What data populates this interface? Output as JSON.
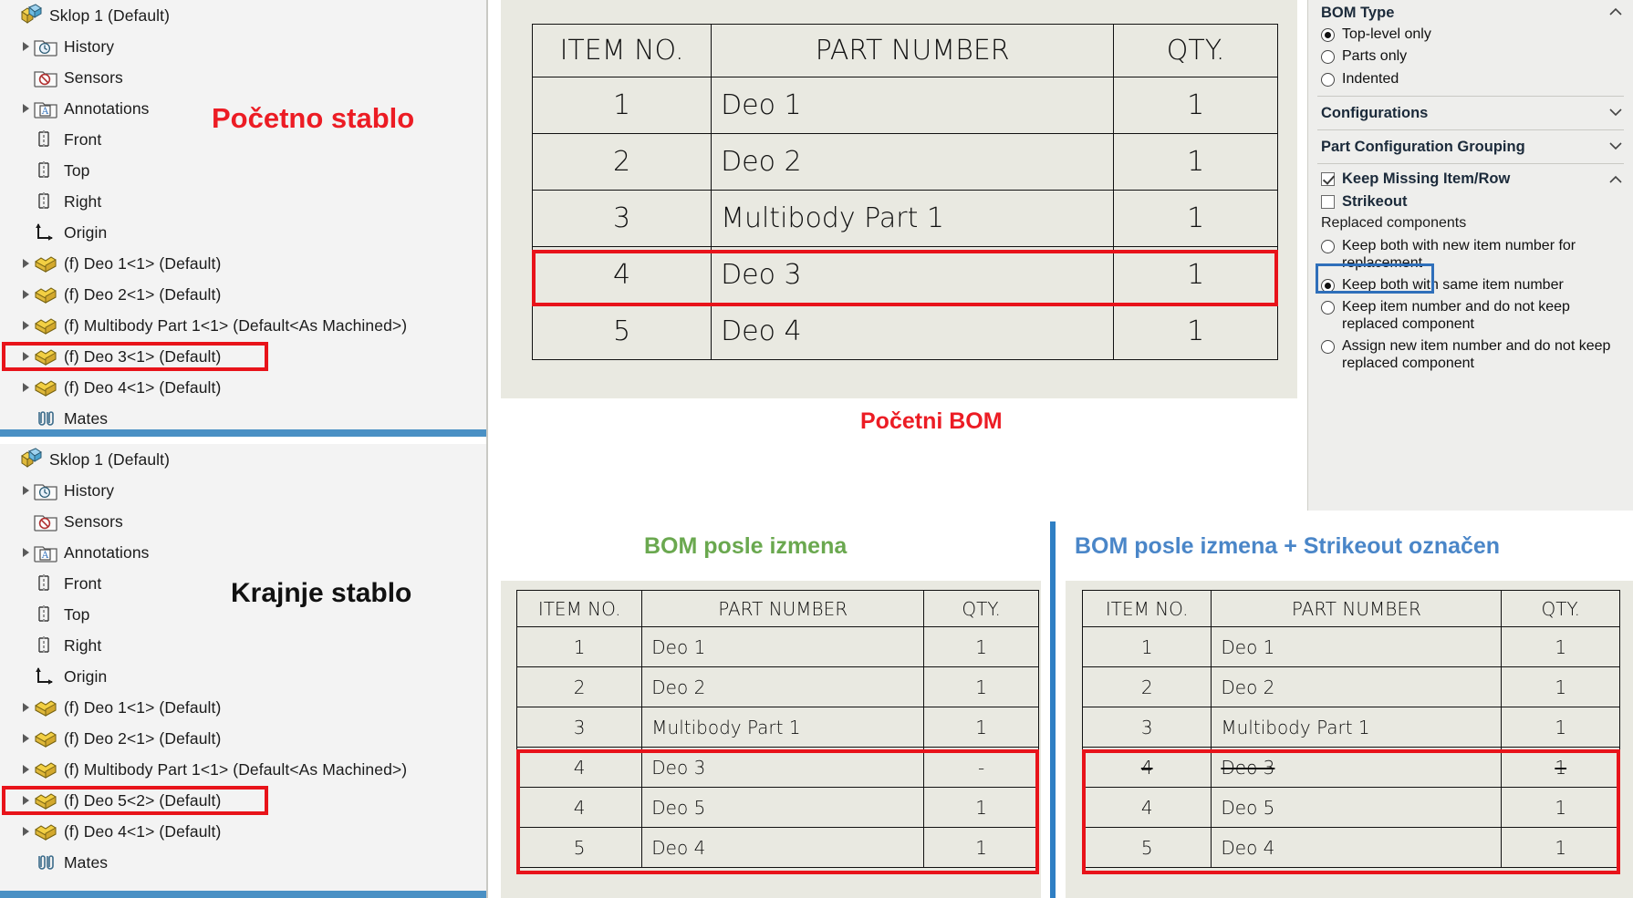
{
  "callouts": {
    "initial_tree": "Početno stablo",
    "final_tree": "Krajnje stablo",
    "initial_bom": "Početni BOM",
    "bom_after": "BOM posle izmena",
    "bom_after_strikeout": "BOM posle izmena + Strikeout označen"
  },
  "colors": {
    "red": "#ec1c24",
    "black": "#111111",
    "green": "#6aa84f",
    "blue": "#4a86c8",
    "highlight_red": "#e8131a",
    "highlight_blue": "#2f6fba",
    "tree_separator": "#4a90c4",
    "panel_bg": "#eeeeec",
    "table_bg": "#e9e9e1"
  },
  "tree_initial": {
    "items": [
      {
        "label": "Sklop 1  (Default)",
        "icon": "assembly-icon",
        "indent": 0,
        "twisty": false,
        "highlighted": false
      },
      {
        "label": "History",
        "icon": "history-folder-icon",
        "indent": 1,
        "twisty": true,
        "highlighted": false
      },
      {
        "label": "Sensors",
        "icon": "sensors-folder-icon",
        "indent": 1,
        "twisty": false,
        "highlighted": false
      },
      {
        "label": "Annotations",
        "icon": "annotations-folder-icon",
        "indent": 1,
        "twisty": true,
        "highlighted": false
      },
      {
        "label": "Front",
        "icon": "plane-icon",
        "indent": 1,
        "twisty": false,
        "highlighted": false
      },
      {
        "label": "Top",
        "icon": "plane-icon",
        "indent": 1,
        "twisty": false,
        "highlighted": false
      },
      {
        "label": "Right",
        "icon": "plane-icon",
        "indent": 1,
        "twisty": false,
        "highlighted": false
      },
      {
        "label": "Origin",
        "icon": "origin-icon",
        "indent": 1,
        "twisty": false,
        "highlighted": false
      },
      {
        "label": "(f) Deo 1<1>  (Default)",
        "icon": "part-icon",
        "indent": 1,
        "twisty": true,
        "highlighted": false
      },
      {
        "label": "(f) Deo 2<1>  (Default)",
        "icon": "part-icon",
        "indent": 1,
        "twisty": true,
        "highlighted": false
      },
      {
        "label": "(f) Multibody Part 1<1>  (Default<As Machined>)",
        "icon": "part-icon",
        "indent": 1,
        "twisty": true,
        "highlighted": false
      },
      {
        "label": "(f) Deo 3<1>  (Default)",
        "icon": "part-icon",
        "indent": 1,
        "twisty": true,
        "highlighted": true
      },
      {
        "label": "(f) Deo 4<1>  (Default)",
        "icon": "part-icon",
        "indent": 1,
        "twisty": true,
        "highlighted": false
      },
      {
        "label": "Mates",
        "icon": "mates-icon",
        "indent": 1,
        "twisty": false,
        "highlighted": false
      }
    ]
  },
  "tree_final": {
    "items": [
      {
        "label": "Sklop 1  (Default)",
        "icon": "assembly-icon",
        "indent": 0,
        "twisty": false,
        "highlighted": false
      },
      {
        "label": "History",
        "icon": "history-folder-icon",
        "indent": 1,
        "twisty": true,
        "highlighted": false
      },
      {
        "label": "Sensors",
        "icon": "sensors-folder-icon",
        "indent": 1,
        "twisty": false,
        "highlighted": false
      },
      {
        "label": "Annotations",
        "icon": "annotations-folder-icon",
        "indent": 1,
        "twisty": true,
        "highlighted": false
      },
      {
        "label": "Front",
        "icon": "plane-icon",
        "indent": 1,
        "twisty": false,
        "highlighted": false
      },
      {
        "label": "Top",
        "icon": "plane-icon",
        "indent": 1,
        "twisty": false,
        "highlighted": false
      },
      {
        "label": "Right",
        "icon": "plane-icon",
        "indent": 1,
        "twisty": false,
        "highlighted": false
      },
      {
        "label": "Origin",
        "icon": "origin-icon",
        "indent": 1,
        "twisty": false,
        "highlighted": false
      },
      {
        "label": "(f) Deo 1<1>  (Default)",
        "icon": "part-icon",
        "indent": 1,
        "twisty": true,
        "highlighted": false
      },
      {
        "label": "(f) Deo 2<1>  (Default)",
        "icon": "part-icon",
        "indent": 1,
        "twisty": true,
        "highlighted": false
      },
      {
        "label": "(f) Multibody Part 1<1>  (Default<As Machined>)",
        "icon": "part-icon",
        "indent": 1,
        "twisty": true,
        "highlighted": false
      },
      {
        "label": "(f) Deo 5<2>  (Default)",
        "icon": "part-icon",
        "indent": 1,
        "twisty": true,
        "highlighted": true
      },
      {
        "label": "(f) Deo 4<1>  (Default)",
        "icon": "part-icon",
        "indent": 1,
        "twisty": true,
        "highlighted": false
      },
      {
        "label": "Mates",
        "icon": "mates-icon",
        "indent": 1,
        "twisty": false,
        "highlighted": false
      }
    ]
  },
  "props": {
    "bom_type": {
      "title": "BOM Type",
      "options": [
        {
          "label": "Top-level only",
          "selected": true
        },
        {
          "label": "Parts only",
          "selected": false
        },
        {
          "label": "Indented",
          "selected": false
        }
      ]
    },
    "configurations_title": "Configurations",
    "part_configuration_grouping_title": "Part Configuration Grouping",
    "keep_missing": {
      "label": "Keep Missing Item/Row",
      "checked": true
    },
    "strikeout": {
      "label": "Strikeout",
      "checked": false,
      "highlighted": true
    },
    "replaced_components": {
      "title": "Replaced components",
      "options": [
        {
          "label": "Keep both with new item number for replacement",
          "selected": false
        },
        {
          "label": "Keep both with same item number",
          "selected": true
        },
        {
          "label": "Keep item number and do not keep replaced component",
          "selected": false
        },
        {
          "label": "Assign new item number and do not keep replaced component",
          "selected": false
        }
      ]
    }
  },
  "bom_initial": {
    "headers": [
      "ITEM NO.",
      "PART NUMBER",
      "QTY."
    ],
    "rows": [
      {
        "item": "1",
        "part": "Deo 1",
        "qty": "1",
        "highlighted": false,
        "strike": false
      },
      {
        "item": "2",
        "part": "Deo 2",
        "qty": "1",
        "highlighted": false,
        "strike": false
      },
      {
        "item": "3",
        "part": "Multibody Part 1",
        "qty": "1",
        "highlighted": false,
        "strike": false
      },
      {
        "item": "4",
        "part": "Deo 3",
        "qty": "1",
        "highlighted": true,
        "strike": false
      },
      {
        "item": "5",
        "part": "Deo 4",
        "qty": "1",
        "highlighted": false,
        "strike": false
      }
    ]
  },
  "bom_after": {
    "headers": [
      "ITEM NO.",
      "PART NUMBER",
      "QTY."
    ],
    "rows": [
      {
        "item": "1",
        "part": "Deo 1",
        "qty": "1",
        "highlighted": false,
        "strike": false
      },
      {
        "item": "2",
        "part": "Deo 2",
        "qty": "1",
        "highlighted": false,
        "strike": false
      },
      {
        "item": "3",
        "part": "Multibody Part 1",
        "qty": "1",
        "highlighted": false,
        "strike": false
      },
      {
        "item": "4",
        "part": "Deo 3",
        "qty": "-",
        "highlighted": true,
        "strike": false
      },
      {
        "item": "4",
        "part": "Deo 5",
        "qty": "1",
        "highlighted": true,
        "strike": false
      },
      {
        "item": "5",
        "part": "Deo 4",
        "qty": "1",
        "highlighted": true,
        "strike": false
      }
    ]
  },
  "bom_after_strikeout": {
    "headers": [
      "ITEM NO.",
      "PART NUMBER",
      "QTY."
    ],
    "rows": [
      {
        "item": "1",
        "part": "Deo 1",
        "qty": "1",
        "highlighted": false,
        "strike": false
      },
      {
        "item": "2",
        "part": "Deo 2",
        "qty": "1",
        "highlighted": false,
        "strike": false
      },
      {
        "item": "3",
        "part": "Multibody Part 1",
        "qty": "1",
        "highlighted": false,
        "strike": false
      },
      {
        "item": "4",
        "part": "Deo 3",
        "qty": "1",
        "highlighted": true,
        "strike": true
      },
      {
        "item": "4",
        "part": "Deo 5",
        "qty": "1",
        "highlighted": true,
        "strike": false
      },
      {
        "item": "5",
        "part": "Deo 4",
        "qty": "1",
        "highlighted": true,
        "strike": false
      }
    ]
  }
}
